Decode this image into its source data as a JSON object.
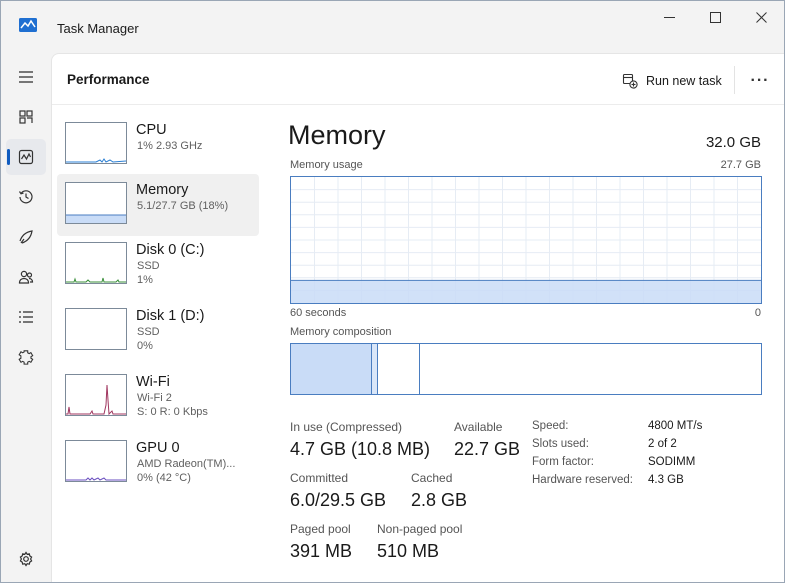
{
  "app": {
    "title": "Task Manager"
  },
  "header": {
    "title": "Performance",
    "run_new_task": "Run new task",
    "more": "···"
  },
  "nav": [
    "menu-icon",
    "processes-icon",
    "performance-icon",
    "app-history-icon",
    "startup-apps-icon",
    "users-icon",
    "details-icon",
    "services-icon",
    "settings-icon"
  ],
  "devices": [
    {
      "name": "CPU",
      "l1": "1% 2.93 GHz",
      "l2": "",
      "l3": ""
    },
    {
      "name": "Memory",
      "l1": "5.1/27.7 GB (18%)",
      "l2": "",
      "l3": ""
    },
    {
      "name": "Disk 0 (C:)",
      "l1": "SSD",
      "l2": "1%",
      "l3": ""
    },
    {
      "name": "Disk 1 (D:)",
      "l1": "SSD",
      "l2": "0%",
      "l3": ""
    },
    {
      "name": "Wi-Fi",
      "l1": "Wi-Fi 2",
      "l2": "S: 0 R: 0 Kbps",
      "l3": ""
    },
    {
      "name": "GPU 0",
      "l1": "AMD Radeon(TM)...",
      "l2": "0% (42 °C)",
      "l3": ""
    }
  ],
  "memory": {
    "title": "Memory",
    "total": "32.0 GB",
    "usage_label": "Memory usage",
    "usage_max": "27.7 GB",
    "time_left": "60 seconds",
    "time_right": "0",
    "usage_fraction": 0.18,
    "composition_label": "Memory composition",
    "stats": {
      "in_use_label": "In use (Compressed)",
      "in_use": "4.7 GB (10.8 MB)",
      "available_label": "Available",
      "available": "22.7 GB",
      "committed_label": "Committed",
      "committed": "6.0/29.5 GB",
      "cached_label": "Cached",
      "cached": "2.8 GB",
      "paged_label": "Paged pool",
      "paged": "391 MB",
      "nonpaged_label": "Non-paged pool",
      "nonpaged": "510 MB"
    },
    "details": {
      "speed_label": "Speed:",
      "speed": "4800 MT/s",
      "slots_label": "Slots used:",
      "slots": "2 of 2",
      "form_label": "Form factor:",
      "form": "SODIMM",
      "reserved_label": "Hardware reserved:",
      "reserved": "4.3 GB"
    }
  },
  "colors": {
    "accent": "#0f5bbf",
    "memory_fill": "#c9dcf7",
    "memory_line": "#4a7dc0",
    "wifi": "#a0365f",
    "cpu": "#2a7fd4"
  }
}
